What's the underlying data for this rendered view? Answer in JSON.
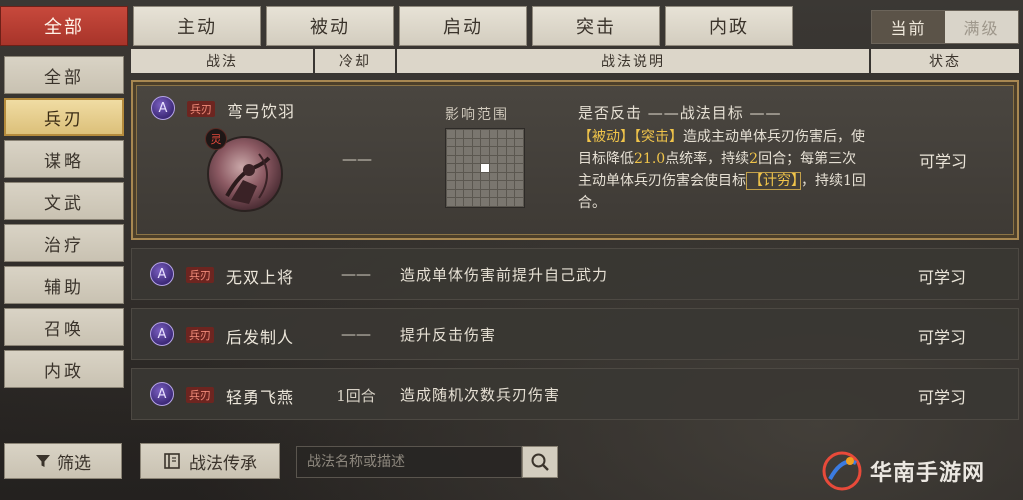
{
  "top_tabs": [
    "全部",
    "主动",
    "被动",
    "启动",
    "突击",
    "内政"
  ],
  "level_toggle": {
    "current": "当前",
    "max": "满级"
  },
  "sidebar": [
    "全部",
    "兵刃",
    "谋略",
    "文武",
    "治疗",
    "辅助",
    "召唤",
    "内政"
  ],
  "filter_label": "筛选",
  "table_headers": {
    "name": "战法",
    "cooldown": "冷却",
    "desc": "战法说明",
    "status": "状态"
  },
  "expanded_row": {
    "grade": "A",
    "type": "兵刃",
    "name": "弯弓饮羽",
    "cooldown": "——",
    "portrait_badge": "灵",
    "range_label": "影响范围",
    "title": "是否反击 ——战法目标 ——",
    "desc_parts": {
      "tag1": "【被动】",
      "tag2": "【突击】",
      "text1": "造成主动单体兵刃伤害后，使目标降低",
      "num1": "21.0",
      "text2": "点统率，持续",
      "num2": "2",
      "text3": "回合；每第三次主动单体兵刃伤害会使目标",
      "tag3": "【计穷】",
      "text4": "，持续1回合。"
    },
    "status": "可学习"
  },
  "rows": [
    {
      "grade": "A",
      "type": "兵刃",
      "name": "无双上将",
      "cooldown": "——",
      "desc": "造成单体伤害前提升自己武力",
      "status": "可学习"
    },
    {
      "grade": "A",
      "type": "兵刃",
      "name": "后发制人",
      "cooldown": "——",
      "desc": "提升反击伤害",
      "status": "可学习"
    },
    {
      "grade": "A",
      "type": "兵刃",
      "name": "轻勇飞燕",
      "cooldown": "1回合",
      "desc": "造成随机次数兵刃伤害",
      "status": "可学习"
    }
  ],
  "inherit_label": "战法传承",
  "search": {
    "placeholder": "战法名称或描述"
  },
  "watermark": "华南手游网",
  "colors": {
    "accent_red": "#b03a2e",
    "gold_border": "#a88852",
    "highlight_yellow": "#f0c44a"
  }
}
